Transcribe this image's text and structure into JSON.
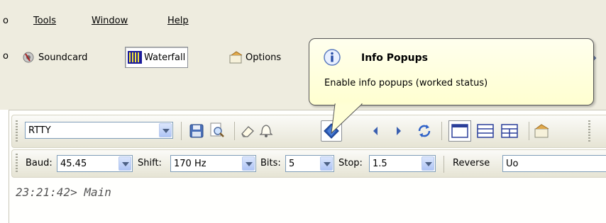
{
  "menu": {
    "partial_left": "o",
    "items": [
      {
        "label": "Tools"
      },
      {
        "label": "Window"
      },
      {
        "label": "Help"
      }
    ]
  },
  "toolbar": {
    "partial_left": "o",
    "soundcard_label": "Soundcard",
    "waterfall_label": "Waterfall",
    "options_label": "Options"
  },
  "tooltip": {
    "title": "Info Popups",
    "body": "Enable info popups (worked status)"
  },
  "mode_combo": {
    "value": "RTTY"
  },
  "settings": {
    "baud_label": "Baud:",
    "baud_value": "45.45",
    "shift_label": "Shift:",
    "shift_value": "170 Hz",
    "bits_label": "Bits:",
    "bits_value": "5",
    "stop_label": "Stop:",
    "stop_value": "1.5",
    "reverse_label": "Reverse",
    "partial_combo_value": "Uo"
  },
  "log": {
    "line": "23:21:42> Main"
  },
  "colors": {
    "chrome": "#eeecdf",
    "tooltip_bg": "#ffffee",
    "combo_border": "#7f9db9"
  }
}
